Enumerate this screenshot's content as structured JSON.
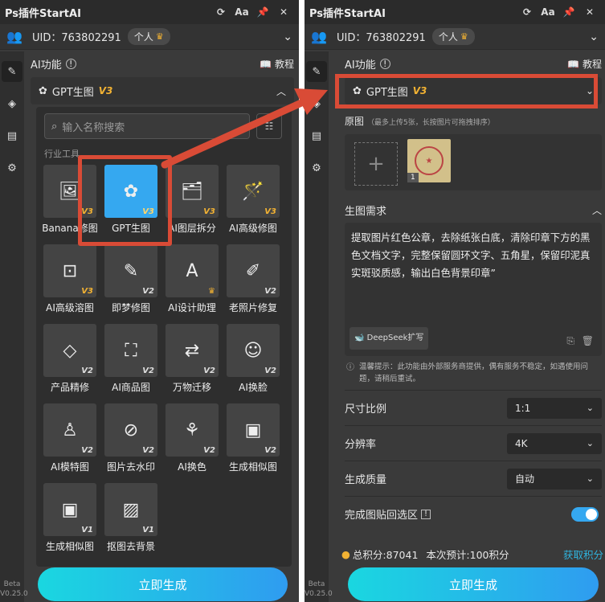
{
  "left": {
    "title": "Ps插件StartAI",
    "uid": "UID：763802291",
    "personal": "个人",
    "ai_func": "AI功能",
    "tutorial": "教程",
    "gpt_label": "GPT生图",
    "gpt_version": "V3",
    "search_placeholder": "输入名称搜索",
    "category": "行业工具",
    "tools": [
      {
        "label": "Banana修图",
        "ver": "V3",
        "icon": "🖼"
      },
      {
        "label": "GPT生图",
        "ver": "V3",
        "icon": "✿"
      },
      {
        "label": "AI图层拆分",
        "ver": "V3",
        "icon": "🗂"
      },
      {
        "label": "AI高级修图",
        "ver": "V3",
        "icon": "🪄"
      },
      {
        "label": "AI高级溶图",
        "ver": "V3",
        "icon": "⊡"
      },
      {
        "label": "即梦修图",
        "ver": "V2",
        "icon": "✎"
      },
      {
        "label": "AI设计助理",
        "ver": "",
        "icon": "A"
      },
      {
        "label": "老照片修复",
        "ver": "V2",
        "icon": "✐"
      },
      {
        "label": "产品精修",
        "ver": "V2",
        "icon": "◇"
      },
      {
        "label": "AI商品图",
        "ver": "V2",
        "icon": "⛶"
      },
      {
        "label": "万物迁移",
        "ver": "V2",
        "icon": "⇄"
      },
      {
        "label": "AI换脸",
        "ver": "V2",
        "icon": "☺"
      },
      {
        "label": "AI模特图",
        "ver": "V2",
        "icon": "♙"
      },
      {
        "label": "图片去水印",
        "ver": "V2",
        "icon": "⊘"
      },
      {
        "label": "AI换色",
        "ver": "V2",
        "icon": "⚘"
      },
      {
        "label": "生成相似图",
        "ver": "V2",
        "icon": "▣"
      },
      {
        "label": "生成相似图",
        "ver": "V1",
        "icon": "▣"
      },
      {
        "label": "抠图去背景",
        "ver": "V1",
        "icon": "▨"
      }
    ],
    "generate": "立即生成",
    "version": [
      "Beta",
      "V0.25.0"
    ]
  },
  "right": {
    "title": "Ps插件StartAI",
    "uid": "UID：763802291",
    "personal": "个人",
    "ai_func": "AI功能",
    "tutorial": "教程",
    "gpt_label": "GPT生图",
    "gpt_version": "V3",
    "orig_label": "原图",
    "orig_hint": "（最多上传5张，长按图片可拖拽排序）",
    "thumb_index": "1",
    "req_label": "生图需求",
    "req_text": "提取图片红色公章，去除纸张白底，清除印章下方的黑色文档文字，完整保留圆环文字、五角星，保留印泥真实斑驳质感，输出白色背景印章”",
    "deepseek": "DeepSeek扩写",
    "warning": "温馨提示：此功能由外部服务商提供，偶有服务不稳定，如遇使用问题，请稍后重试。",
    "ratio_label": "尺寸比例",
    "ratio_value": "1:1",
    "res_label": "分辨率",
    "res_value": "4K",
    "quality_label": "生成质量",
    "quality_value": "自动",
    "paste_label": "完成图贴回选区",
    "points": "总积分:87041",
    "estimate": "本次预计:100积分",
    "get_points": "获取积分",
    "generate": "立即生成",
    "version": [
      "Beta",
      "V0.25.0"
    ]
  },
  "colors": {
    "accent": "#35a8f0",
    "highlight": "#d94b36",
    "gold": "#f2b233"
  }
}
